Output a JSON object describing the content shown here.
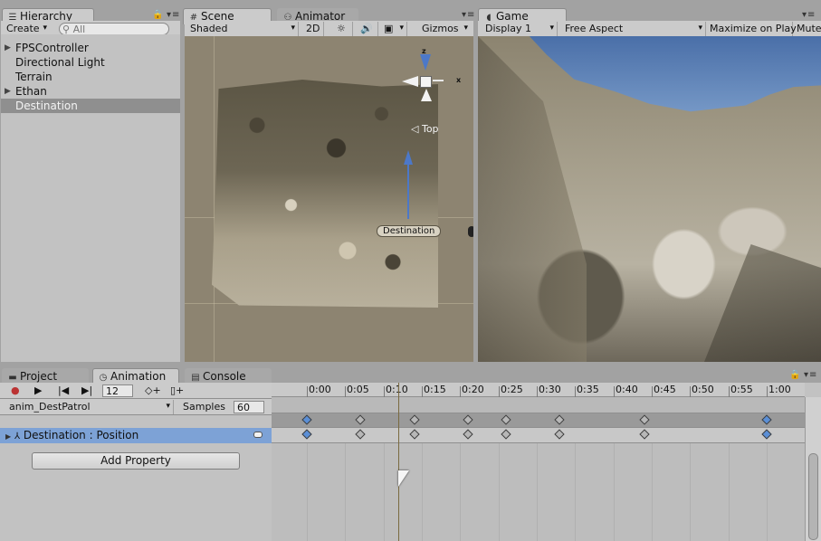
{
  "hierarchy": {
    "tab": "Hierarchy",
    "create": "Create",
    "search_placeholder": "All",
    "items": [
      {
        "label": "FPSController",
        "expandable": true
      },
      {
        "label": "Directional Light",
        "expandable": false
      },
      {
        "label": "Terrain",
        "expandable": false
      },
      {
        "label": "Ethan",
        "expandable": true
      },
      {
        "label": "Destination",
        "expandable": false,
        "selected": true
      }
    ]
  },
  "scene": {
    "tab": "Scene",
    "animator_tab": "Animator",
    "shading": "Shaded",
    "mode_2d": "2D",
    "gizmos": "Gizmos",
    "gizmo_view": "Top",
    "axis_z": "z",
    "axis_x": "x",
    "object_label": "Destination"
  },
  "game": {
    "tab": "Game",
    "display": "Display 1",
    "aspect": "Free Aspect",
    "maximize": "Maximize on Play",
    "mute": "Mute"
  },
  "bottom_tabs": {
    "project": "Project",
    "animation": "Animation",
    "console": "Console"
  },
  "animation": {
    "frame": "12",
    "clip": "anim_DestPatrol",
    "samples_label": "Samples",
    "samples": "60",
    "property": "Destination : Position",
    "add_property": "Add Property",
    "time_labels": [
      "0:00",
      "0:05",
      "0:10",
      "0:15",
      "0:20",
      "0:25",
      "0:30",
      "0:35",
      "0:40",
      "0:45",
      "0:50",
      "0:55",
      "1:00"
    ],
    "keyframe_times": [
      "0:00",
      "0:07",
      "0:14",
      "0:21",
      "0:26",
      "0:33",
      "0:44",
      "1:00"
    ]
  },
  "colors": {
    "selection": "#8f8f8f",
    "property_row": "#7da2d6",
    "key_blue": "#5b8fd6"
  }
}
